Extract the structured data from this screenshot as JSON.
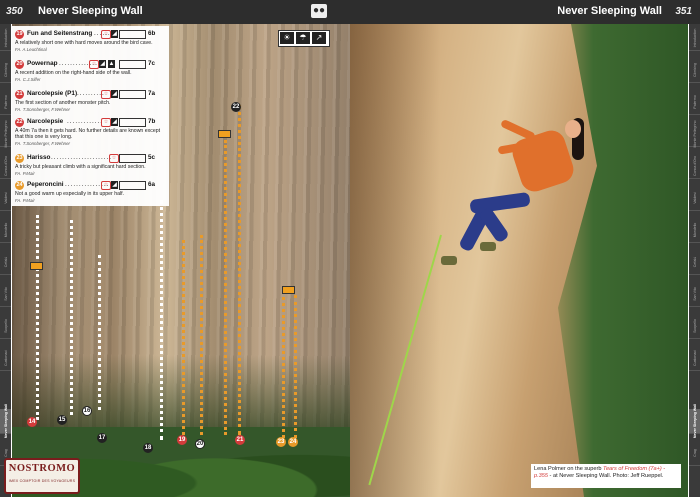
{
  "header": {
    "page_left": "350",
    "title_left": "Never Sleeping Wall",
    "page_right": "351",
    "title_right": "Never Sleeping Wall",
    "family_icon": "family-icon"
  },
  "routes": [
    {
      "num": "19",
      "color": "#d33b3b",
      "name": "Fun and Seitenstrang",
      "dots": ".........",
      "grade": "6b",
      "desc": "A relatively short one with hard moves around the bird cave.",
      "fa": "FA. A.Leuchtinal"
    },
    {
      "num": "20",
      "color": "#d33b3b",
      "name": "Powernap",
      "dots": "................",
      "grade": "7c",
      "desc": "A recent addition on the right-hand side of the wall.",
      "fa": "FA. C.J.Silfer"
    },
    {
      "num": "21",
      "color": "#d33b3b",
      "name": "Narcolepsie (P1)",
      "dots": "..........",
      "grade": "7a",
      "desc": "The first section of another monster pitch.",
      "fa": "FA. T.Sonnberger, F.Wehner"
    },
    {
      "num": "22",
      "color": "#d33b3b",
      "name": "Narcolepsie",
      "dots": ".............",
      "grade": "7b",
      "desc": "A 40m 7a then it gets hard. No further details are known except that this one is very long.",
      "fa": "FA. T.Sonnberger, F.Wehner"
    },
    {
      "num": "23",
      "color": "#e89a2a",
      "name": "Harisso",
      "dots": "......................",
      "grade": "5c",
      "desc": "A tricky but pleasant climb with a significant hard section.",
      "fa": "FA. P.Mair"
    },
    {
      "num": "24",
      "color": "#e89a2a",
      "name": "Peperoncini",
      "dots": ".................",
      "grade": "6a",
      "desc": "Not a good warm up especially in its upper half.",
      "fa": "FA. P.Mair"
    }
  ],
  "wall_icons": [
    "sun-shade-icon",
    "rain-icon",
    "approach-icon"
  ],
  "markers": [
    {
      "num": "14",
      "style": "red"
    },
    {
      "num": "15",
      "style": "blk"
    },
    {
      "num": "16",
      "style": "wht"
    },
    {
      "num": "17",
      "style": "blk"
    },
    {
      "num": "18",
      "style": "blk"
    },
    {
      "num": "19",
      "style": "red"
    },
    {
      "num": "20",
      "style": "wht"
    },
    {
      "num": "21",
      "style": "red"
    },
    {
      "num": "22",
      "style": "blk"
    },
    {
      "num": "23",
      "style": "org"
    },
    {
      "num": "24",
      "style": "org"
    }
  ],
  "logo": {
    "name": "NOSTROMO",
    "tagline": "IMEX COMPTOIR DES VOYAGEURS"
  },
  "caption": {
    "before": "Lena Polmer on the superb ",
    "route_ref": "Tears of Freedom (7a+) - p.355",
    "after": " - at Never Sleeping Wall. Photo: Jeff Rueppel."
  },
  "thumb_tabs_left": [
    "Introduction",
    "Climbing",
    "Palermo",
    "Monte Pellegrino",
    "Conca d'Oro",
    "Valdesi",
    "Mondello",
    "Cefalù",
    "San Vito",
    "Scopello",
    "Custonaci",
    "Never Sleeping Wall",
    "Crag"
  ],
  "thumb_tabs_right": [
    "Introduction",
    "Climbing",
    "Palermo",
    "Monte Pellegrino",
    "Conca d'Oro",
    "Valdesi",
    "Mondello",
    "Cefalù",
    "San Vito",
    "Scopello",
    "Custonaci",
    "Never Sleeping Wall",
    "Crag"
  ],
  "active_tab": "Never Sleeping Wall"
}
